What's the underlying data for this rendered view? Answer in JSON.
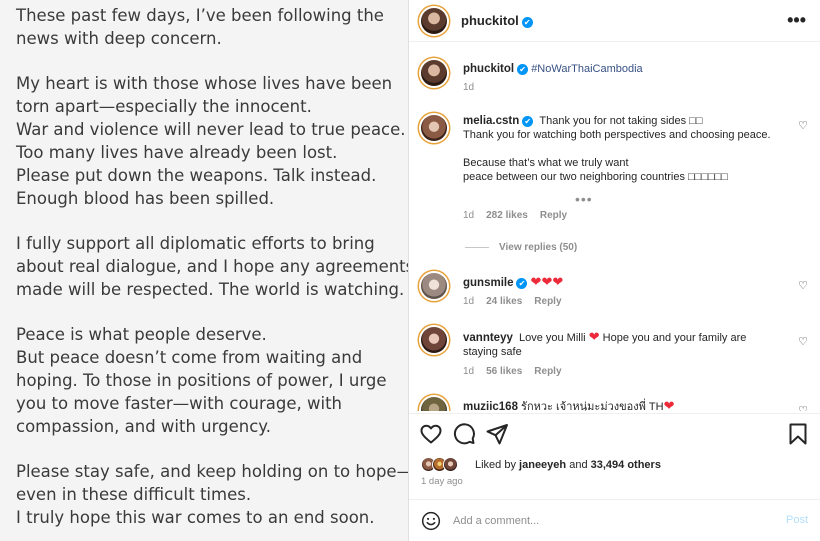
{
  "post_image": {
    "paragraphs": [
      [
        "These past few days, I’ve been following the",
        "news with deep concern."
      ],
      [
        "My heart is with those whose lives have been",
        "torn apart—especially the innocent.",
        "War and violence will never lead to true peace.",
        "Too many lives have already been lost.",
        "Please put down the weapons. Talk instead.",
        "Enough blood has been spilled."
      ],
      [
        "I fully support all diplomatic efforts to bring",
        "about real dialogue, and I hope any agreements",
        "made will be respected. The world is watching."
      ],
      [
        "Peace is what people deserve.",
        "But peace doesn’t come from waiting and",
        "hoping. To those in positions of power, I urge",
        "you to move faster—with courage, with",
        "compassion, and with urgency."
      ],
      [
        "Please stay safe, and keep holding on to hope—",
        "even in these difficult times.",
        "I truly hope this war comes to an end soon."
      ]
    ]
  },
  "header": {
    "username": "phuckitol",
    "verified_mark": "✔",
    "more_icon": "more-horizontal-icon",
    "more_glyph": "•••"
  },
  "caption": {
    "username": "phuckitol",
    "hashtag": "#NoWarThaiCambodia",
    "time": "1d"
  },
  "comments": [
    {
      "username": "melia.cstn",
      "verified": true,
      "lines": [
        "Thank you for not taking sides □□",
        "Thank you for watching both perspectives and choosing peace.",
        "",
        "Because that’s what we truly want",
        "peace between our two neighboring countries □□□□□□"
      ],
      "more": "•••",
      "time": "1d",
      "likes": "282 likes",
      "reply": "Reply",
      "view_replies": "View replies (50)"
    },
    {
      "username": "gunsmile",
      "verified": true,
      "text": "❤❤❤",
      "time": "1d",
      "likes": "24 likes",
      "reply": "Reply"
    },
    {
      "username": "vannteyy",
      "verified": false,
      "text_a": "Love you Milli",
      "heart": "❤",
      "text_b": "Hope you and your family are",
      "text_c": "staying safe",
      "time": "1d",
      "likes": "56 likes",
      "reply": "Reply"
    },
    {
      "username": "muziic168",
      "verified": false,
      "text": "รักหวะ เจ้าหนุ่มะม่วงของพี่ TH",
      "heart": "❤"
    }
  ],
  "like_icon_glyph": "♡",
  "likes_summary": {
    "prefix": "Liked by",
    "user": "janeeyeh",
    "and": "and",
    "count": "33,494 others"
  },
  "post_time": "1 day ago",
  "add_comment": {
    "placeholder": "Add a comment...",
    "post_label": "Post"
  },
  "colors": {
    "accent": "#0095f6",
    "heart_red": "#ed2a3a",
    "hashtag": "#385185",
    "muted": "#8e8e8e"
  }
}
